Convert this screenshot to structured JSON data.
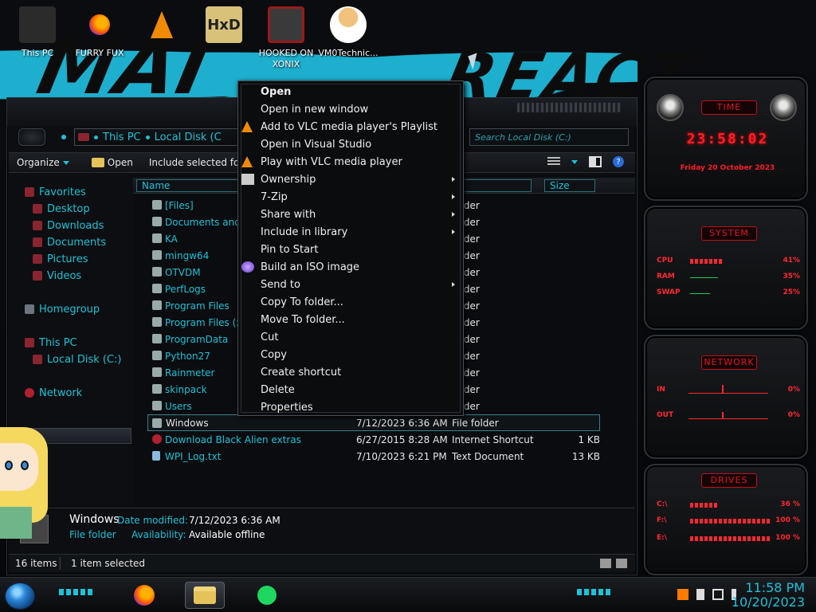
{
  "wallpaper": {
    "accent": "#1fb8d8",
    "text_left": "MAI",
    "text_right": "REACT"
  },
  "desktop_icons": [
    {
      "label": "This PC",
      "icon": "computer-icon",
      "color": "#2b2b2b"
    },
    {
      "label": "FURRY FUX",
      "icon": "firefox-icon",
      "color": "#ff6a00"
    },
    {
      "label": "",
      "icon": "vlc-icon",
      "color": "#f08a00"
    },
    {
      "label": "",
      "icon": "hxd-icon",
      "color": "#d8c27a"
    },
    {
      "label": "HOOKED ON XONIX",
      "icon": "game-icon",
      "color": "#9a1a1a"
    },
    {
      "label": "VM0Technic...",
      "icon": "doctor-icon",
      "color": "#f1c27d"
    }
  ],
  "explorer": {
    "address_root": "This PC",
    "address_current": "Local Disk (C",
    "search_placeholder": "Search Local Disk (C:)",
    "toolbar": {
      "organize": "Organize",
      "open": "Open",
      "include": "Include selected fol"
    },
    "nav": {
      "favorites": "Favorites",
      "desktop": "Desktop",
      "downloads": "Downloads",
      "documents": "Documents",
      "pictures": "Pictures",
      "videos": "Videos",
      "homegroup": "Homegroup",
      "this_pc": "This PC",
      "local_disk": "Local Disk (C:)",
      "network": "Network"
    },
    "columns": {
      "name": "Name",
      "type": "e",
      "size": "Size"
    },
    "rows": [
      {
        "name": "[Files]",
        "date": "",
        "type": "folder",
        "size": ""
      },
      {
        "name": "Documents and Se",
        "date": "",
        "type": "folder",
        "size": ""
      },
      {
        "name": "KA",
        "date": "",
        "type": "folder",
        "size": ""
      },
      {
        "name": "mingw64",
        "date": "",
        "type": "folder",
        "size": ""
      },
      {
        "name": "OTVDM",
        "date": "",
        "type": "folder",
        "size": ""
      },
      {
        "name": "PerfLogs",
        "date": "",
        "type": "folder",
        "size": ""
      },
      {
        "name": "Program Files",
        "date": "",
        "type": "folder",
        "size": ""
      },
      {
        "name": "Program Files (x86",
        "date": "",
        "type": "folder",
        "size": ""
      },
      {
        "name": "ProgramData",
        "date": "",
        "type": "folder",
        "size": ""
      },
      {
        "name": "Python27",
        "date": "",
        "type": "folder",
        "size": ""
      },
      {
        "name": "Rainmeter",
        "date": "",
        "type": "folder",
        "size": ""
      },
      {
        "name": "skinpack",
        "date": "",
        "type": "folder",
        "size": ""
      },
      {
        "name": "Users",
        "date": "",
        "type": "folder",
        "size": ""
      },
      {
        "name": "Windows",
        "date": "7/12/2023 6:36 AM",
        "type": "File folder",
        "size": ""
      },
      {
        "name": "Download Black Alien extras",
        "date": "6/27/2015 8:28 AM",
        "type": "Internet Shortcut",
        "size": "1 KB"
      },
      {
        "name": "WPI_Log.txt",
        "date": "7/10/2023 6:21 PM",
        "type": "Text Document",
        "size": "13 KB"
      }
    ],
    "details": {
      "name": "Windows",
      "type": "File folder",
      "modified_label": "Date modified:",
      "modified_value": "7/12/2023 6:36 AM",
      "availability_label": "Availability:",
      "availability_value": "Available offline"
    },
    "status": {
      "items": "16 items",
      "selected": "1 item selected"
    }
  },
  "context_menu": {
    "items": [
      {
        "label": "Open",
        "bold": true,
        "icon": "",
        "submenu": false
      },
      {
        "label": "Open in new window",
        "bold": false,
        "icon": "",
        "submenu": false
      },
      {
        "label": "Add to VLC media player's Playlist",
        "bold": false,
        "icon": "vlc",
        "submenu": false
      },
      {
        "label": "Open in Visual Studio",
        "bold": false,
        "icon": "",
        "submenu": false
      },
      {
        "label": "Play with VLC media player",
        "bold": false,
        "icon": "vlc",
        "submenu": false
      },
      {
        "label": "Ownership",
        "bold": false,
        "icon": "own",
        "submenu": true
      },
      {
        "label": "7-Zip",
        "bold": false,
        "icon": "",
        "submenu": true
      },
      {
        "label": "Share with",
        "bold": false,
        "icon": "",
        "submenu": true
      },
      {
        "label": "Include in library",
        "bold": false,
        "icon": "",
        "submenu": true
      },
      {
        "label": "Pin to Start",
        "bold": false,
        "icon": "",
        "submenu": false
      },
      {
        "label": "Build an ISO image",
        "bold": false,
        "icon": "iso",
        "submenu": false
      },
      {
        "label": "Send to",
        "bold": false,
        "icon": "",
        "submenu": true
      },
      {
        "label": "Copy To folder...",
        "bold": false,
        "icon": "",
        "submenu": false
      },
      {
        "label": "Move To folder...",
        "bold": false,
        "icon": "",
        "submenu": false
      },
      {
        "label": "Cut",
        "bold": false,
        "icon": "",
        "submenu": false
      },
      {
        "label": "Copy",
        "bold": false,
        "icon": "",
        "submenu": false
      },
      {
        "label": "Create shortcut",
        "bold": false,
        "icon": "",
        "submenu": false
      },
      {
        "label": "Delete",
        "bold": false,
        "icon": "",
        "submenu": false
      },
      {
        "label": "Properties",
        "bold": false,
        "icon": "",
        "submenu": false
      }
    ]
  },
  "gadgets": {
    "time": {
      "title": "TIME",
      "clock": "23:58:02",
      "date": "Friday 20 October 2023"
    },
    "system": {
      "title": "SYSTEM",
      "cpu": {
        "label": "CPU",
        "value": "41%",
        "level": 0.41
      },
      "ram": {
        "label": "RAM",
        "value": "35%",
        "level": 0.35
      },
      "swap": {
        "label": "SWAP",
        "value": "25%",
        "level": 0.25
      }
    },
    "network": {
      "title": "NETWORK",
      "in": {
        "label": "IN",
        "value": "0%"
      },
      "out": {
        "label": "OUT",
        "value": "0%"
      }
    },
    "drives": {
      "title": "DRIVES",
      "c": {
        "label": "C:\\",
        "value": "36 %",
        "level": 0.36
      },
      "f": {
        "label": "F:\\",
        "value": "100 %",
        "level": 1.0
      },
      "e": {
        "label": "E:\\",
        "value": "100 %",
        "level": 1.0
      }
    }
  },
  "taskbar": {
    "time": "11:58 PM",
    "date": "10/20/2023",
    "apps": [
      "firefox",
      "file-explorer",
      "spotify"
    ]
  }
}
